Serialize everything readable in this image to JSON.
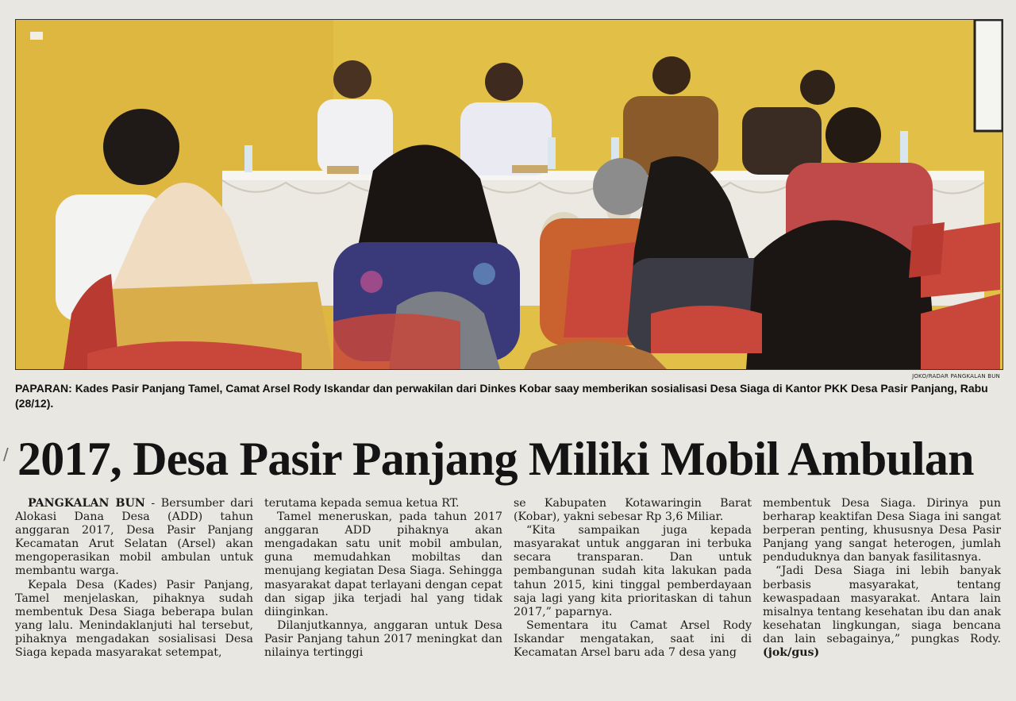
{
  "photo": {
    "credit": "JOKO/RADAR PANGKALAN BUN",
    "caption": "PAPARAN: Kades Pasir Panjang Tamel, Camat Arsel Rody Iskandar dan perwakilan dari Dinkes Kobar  saay memberikan sosialisasi Desa Siaga di Kantor PKK Desa Pasir Panjang, Rabu (28/12)."
  },
  "article": {
    "headline": "2017, Desa Pasir Panjang Miliki Mobil Ambulan",
    "dateline": "PANGKALAN BUN",
    "col1_p1_rest": " - Bersumber dari Alokasi Dana Desa (ADD) tahun anggaran 2017, Desa Pasir Panjang Kecamatan Arut Selatan (Arsel) akan mengoperasikan mobil ambulan untuk membantu warga.",
    "col1_p2": "Kepala Desa (Kades) Pasir Panjang, Tamel menjelaskan, pihaknya sudah membentuk Desa Siaga beberapa bulan yang lalu. Menindaklanjuti hal tersebut, pihaknya mengadakan sosialisasi Desa Siaga kepada masyarakat  setempat,",
    "col2_p1": "terutama kepada semua ketua RT.",
    "col2_p2": "Tamel meneruskan, pada tahun 2017 anggaran ADD pihaknya akan mengadakan satu unit mobil ambulan, guna memudahkan mobiltas dan menujang kegiatan Desa Siaga. Sehingga masyarakat dapat terlayani dengan cepat dan sigap jika terjadi hal yang tidak diinginkan.",
    "col2_p3": "Dilanjutkannya, anggaran untuk Desa Pasir Panjang tahun 2017 meningkat dan nilainya tertinggi",
    "col3_p1": "se Kabupaten Kotawaringin Barat (Kobar), yakni sebesar Rp 3,6 Miliar.",
    "col3_p2": "“Kita sampaikan juga kepada masyarakat untuk anggaran ini terbuka secara transparan. Dan untuk pembangunan sudah kita lakukan pada tahun 2015, kini tinggal pemberdayaan saja lagi yang kita prioritaskan di tahun 2017,” paparnya.",
    "col3_p3": "Sementara itu Camat Arsel Rody Iskandar mengatakan, saat ini di Kecamatan Arsel baru ada 7 desa yang",
    "col4_p1": "membentuk Desa Siaga. Dirinya pun berharap keaktifan Desa Siaga ini sangat berperan penting, khususnya Desa Pasir Panjang yang sangat heterogen, jumlah penduduknya dan banyak fasilitasnya.",
    "col4_p2": "“Jadi Desa Siaga ini lebih banyak berbasis masyarakat, tentang kewaspadaan masyarakat. Antara lain misalnya tentang kesehatan ibu dan anak kesehatan lingkungan, siaga bencana dan lain sebagainya,” pungkas Rody. ",
    "signature": "(jok/gus)"
  }
}
